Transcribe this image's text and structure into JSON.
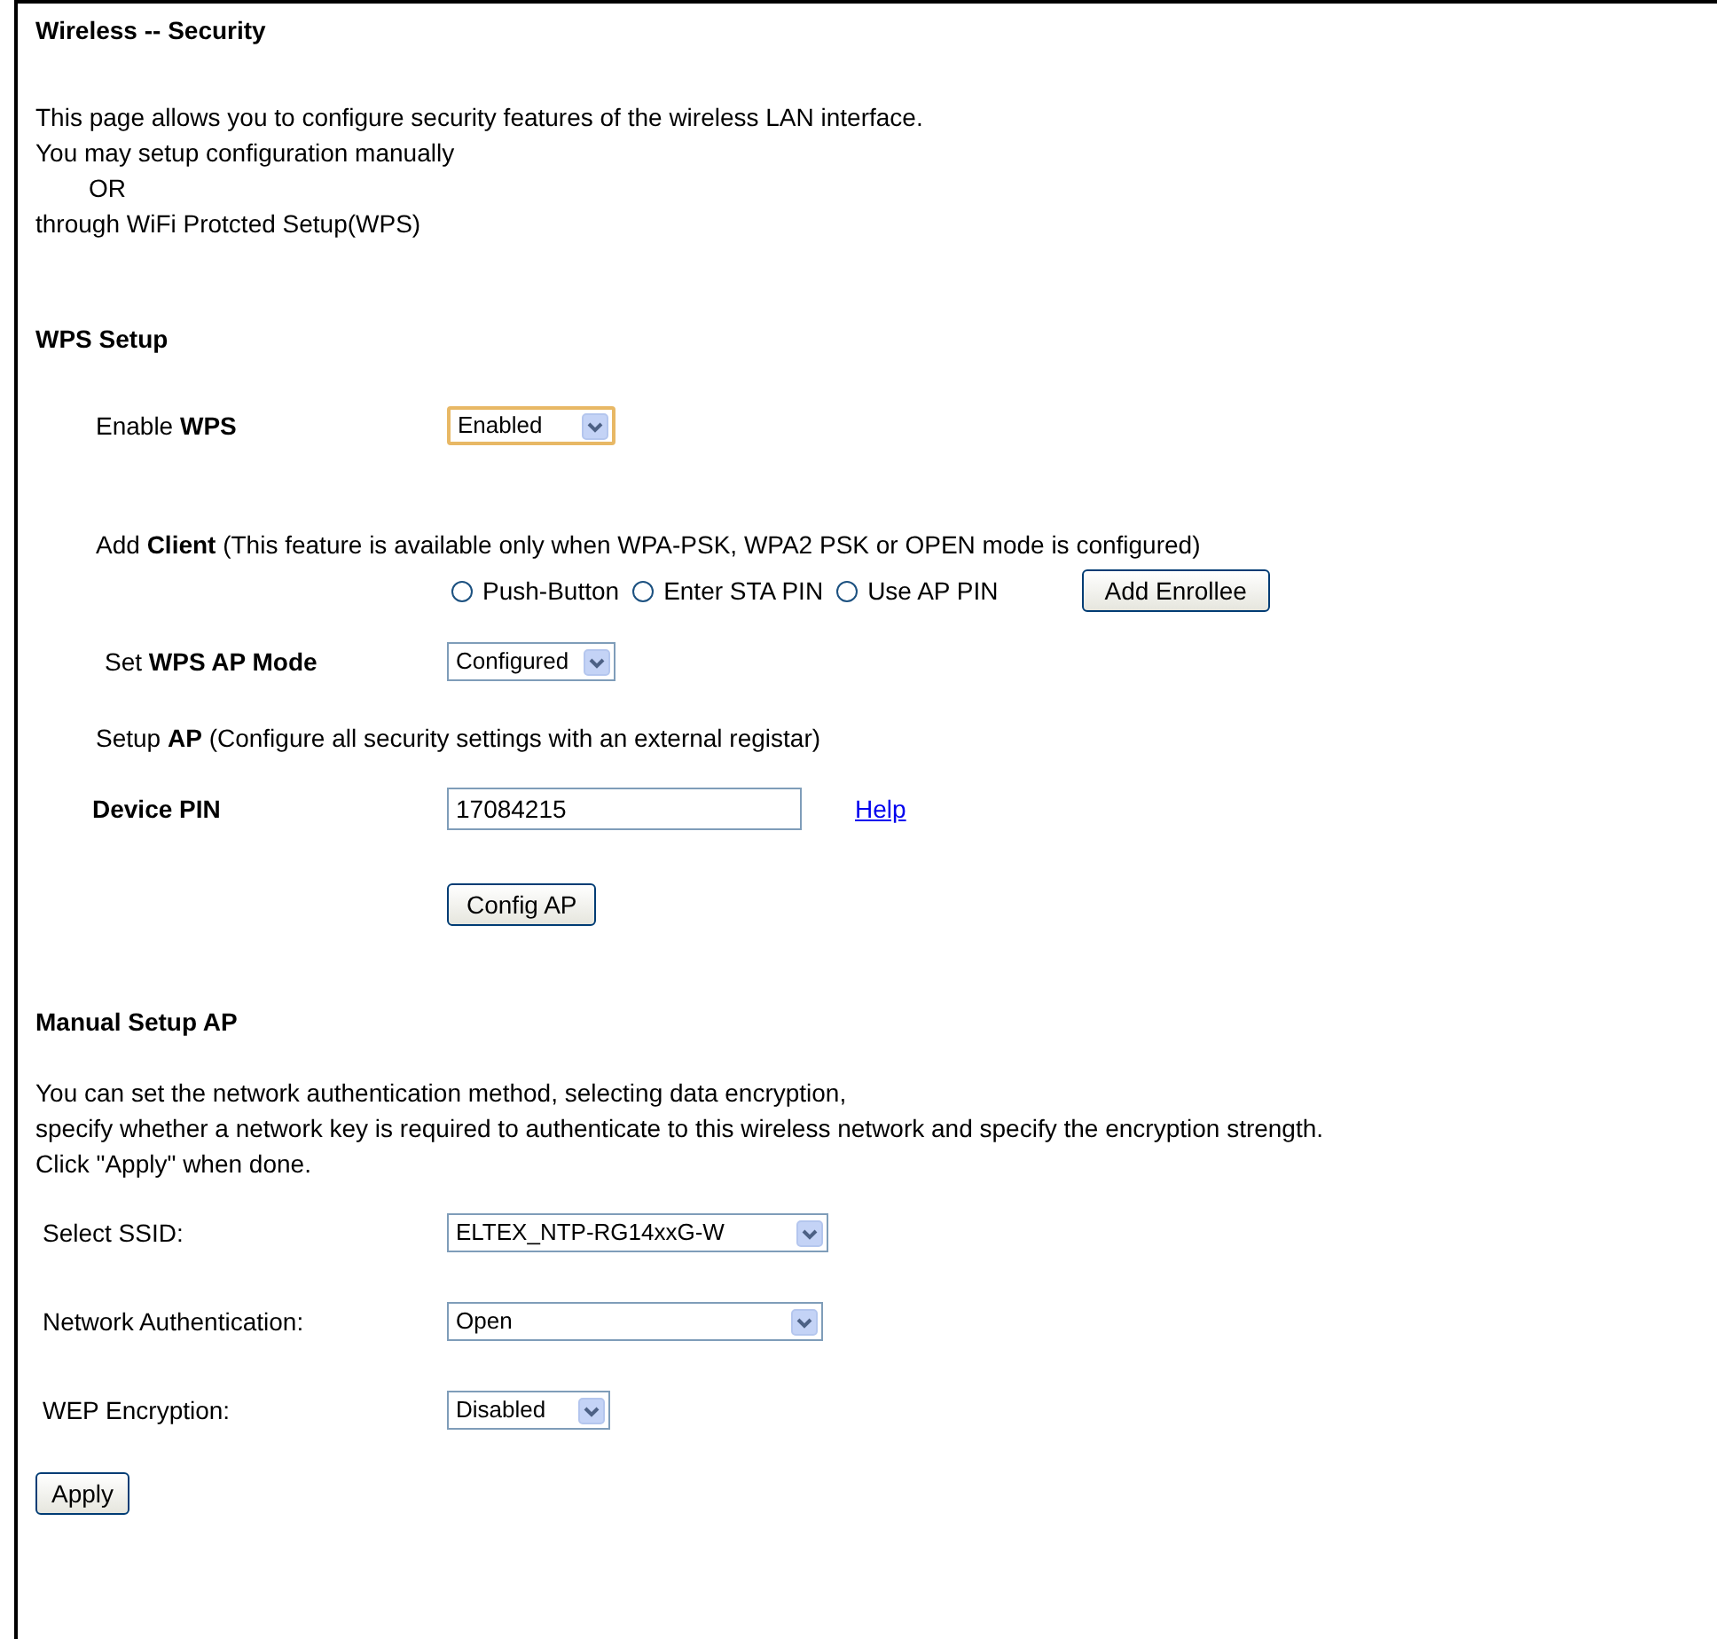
{
  "title": "Wireless -- Security",
  "intro": [
    "This page allows you to configure security features of the wireless LAN interface.",
    "You may setup configuration manually",
    "OR",
    "through WiFi Protcted Setup(WPS)"
  ],
  "wps": {
    "heading": "WPS Setup",
    "enable": {
      "label": "Enable **WPS**",
      "value": "Enabled",
      "focused": true
    },
    "add_client": {
      "label": "Add **Client** (This feature is available only when WPA-PSK, WPA2 PSK or OPEN mode is configured)",
      "options": [
        {
          "label": "Push-Button",
          "selected": false
        },
        {
          "label": "Enter STA PIN",
          "selected": false
        },
        {
          "label": "Use AP PIN",
          "selected": false
        }
      ],
      "button": "Add Enrollee"
    },
    "ap_mode": {
      "label": "Set **WPS AP Mode**",
      "value": "Configured",
      "focused": false
    },
    "setup_ap": "Setup **AP** (Configure all security settings with an external registar)",
    "device_pin": {
      "label": "Device PIN",
      "value": "17084215",
      "link": "Help"
    },
    "config_button": "Config AP"
  },
  "manual": {
    "heading": "Manual Setup AP",
    "description": [
      "You can set the network authentication method, selecting data encryption,",
      "specify whether a network key is required to authenticate to this wireless network and specify the encryption strength.",
      "Click \"Apply\" when done."
    ],
    "fields": [
      {
        "label": "Select SSID:",
        "value": "ELTEX_NTP-RG14xxG-W",
        "focused": false
      },
      {
        "label": "Network Authentication:",
        "value": "Open",
        "focused": false
      },
      {
        "label": "WEP Encryption:",
        "value": "Disabled",
        "focused": false
      }
    ],
    "button": "Apply"
  }
}
